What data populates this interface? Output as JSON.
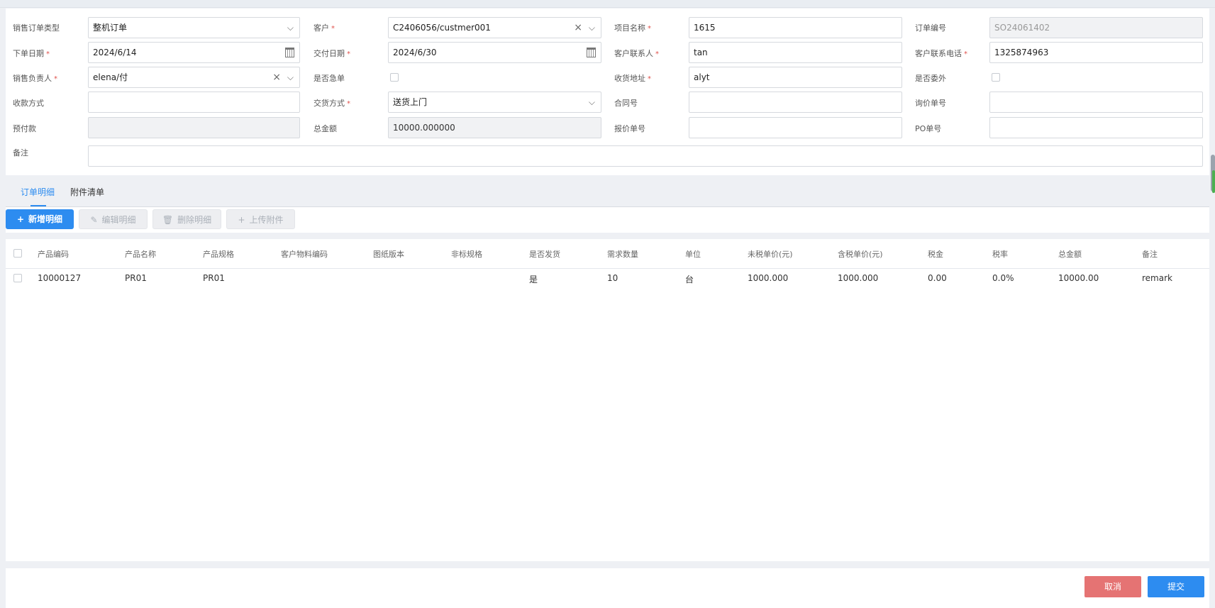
{
  "form": {
    "order_type": {
      "label": "销售订单类型",
      "value": "整机订单"
    },
    "customer": {
      "label": "客户",
      "value": "C2406056/custmer001"
    },
    "project_name": {
      "label": "项目名称",
      "value": "1615"
    },
    "order_no": {
      "label": "订单编号",
      "value": "SO24061402"
    },
    "order_date": {
      "label": "下单日期",
      "value": "2024/6/14"
    },
    "delivery_date": {
      "label": "交付日期",
      "value": "2024/6/30"
    },
    "contact": {
      "label": "客户联系人",
      "value": "tan"
    },
    "contact_phone": {
      "label": "客户联系电话",
      "value": "1325874963"
    },
    "sales_owner": {
      "label": "销售负责人",
      "value": "elena/付"
    },
    "urgent": {
      "label": "是否急单"
    },
    "ship_address": {
      "label": "收货地址",
      "value": "alyt"
    },
    "outsource": {
      "label": "是否委外"
    },
    "payment_method": {
      "label": "收款方式",
      "value": ""
    },
    "delivery_method": {
      "label": "交货方式",
      "value": "送货上门"
    },
    "contract_no": {
      "label": "合同号",
      "value": ""
    },
    "inquiry_no": {
      "label": "询价单号",
      "value": ""
    },
    "prepayment": {
      "label": "预付款",
      "value": ""
    },
    "total_amount": {
      "label": "总金额",
      "value": "10000.000000"
    },
    "quote_no": {
      "label": "报价单号",
      "value": ""
    },
    "po_no": {
      "label": "PO单号",
      "value": ""
    },
    "remark": {
      "label": "备注",
      "value": ""
    },
    "required_mark": "*"
  },
  "tabs": [
    {
      "label": "订单明细"
    },
    {
      "label": "附件清单"
    }
  ],
  "toolbar": {
    "add": "新增明细",
    "edit": "编辑明细",
    "delete": "删除明细",
    "upload": "上传附件"
  },
  "table": {
    "headers": [
      "产品编码",
      "产品名称",
      "产品规格",
      "客户物料编码",
      "图纸版本",
      "非标规格",
      "是否发货",
      "需求数量",
      "单位",
      "未税单价(元)",
      "含税单价(元)",
      "税金",
      "税率",
      "总金额",
      "备注"
    ],
    "rows": [
      [
        "10000127",
        "PR01",
        "PR01",
        "",
        "",
        "",
        "是",
        "10",
        "台",
        "1000.000",
        "1000.000",
        "0.00",
        "0.0%",
        "10000.00",
        "remark"
      ]
    ]
  },
  "footer": {
    "cancel": "取消",
    "submit": "提交"
  },
  "colors": {
    "primary": "#2d8cf0",
    "cancel": "#e57373",
    "required": "#e0524d"
  }
}
